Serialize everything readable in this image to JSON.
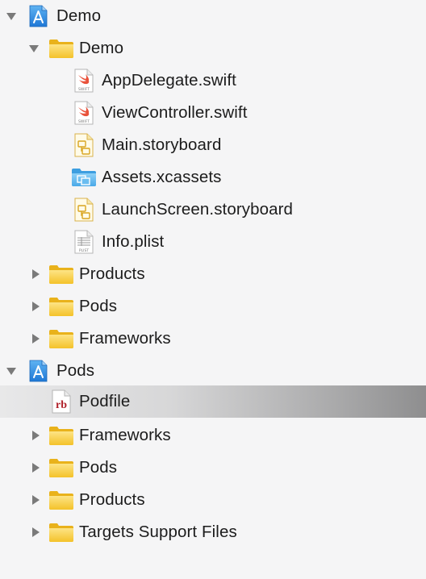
{
  "navigator": {
    "items": [
      {
        "label": "Demo",
        "icon": "xcode-project-icon",
        "state": "expanded"
      },
      {
        "label": "Demo",
        "icon": "folder-icon",
        "state": "expanded"
      },
      {
        "label": "AppDelegate.swift",
        "icon": "swift-file-icon",
        "badge": "SWIFT"
      },
      {
        "label": "ViewController.swift",
        "icon": "swift-file-icon",
        "badge": "SWIFT"
      },
      {
        "label": "Main.storyboard",
        "icon": "storyboard-file-icon"
      },
      {
        "label": "Assets.xcassets",
        "icon": "asset-catalog-icon"
      },
      {
        "label": "LaunchScreen.storyboard",
        "icon": "storyboard-file-icon"
      },
      {
        "label": "Info.plist",
        "icon": "plist-file-icon",
        "badge": "PLIST"
      },
      {
        "label": "Products",
        "icon": "folder-icon",
        "state": "collapsed"
      },
      {
        "label": "Pods",
        "icon": "folder-icon",
        "state": "collapsed"
      },
      {
        "label": "Frameworks",
        "icon": "folder-icon",
        "state": "collapsed"
      },
      {
        "label": "Pods",
        "icon": "xcode-project-icon",
        "state": "expanded"
      },
      {
        "label": "Podfile",
        "icon": "ruby-file-icon",
        "badge": "rb",
        "selected": true
      },
      {
        "label": "Frameworks",
        "icon": "folder-icon",
        "state": "collapsed"
      },
      {
        "label": "Pods",
        "icon": "folder-icon",
        "state": "collapsed"
      },
      {
        "label": "Products",
        "icon": "folder-icon",
        "state": "collapsed"
      },
      {
        "label": "Targets Support Files",
        "icon": "folder-icon",
        "state": "collapsed"
      }
    ]
  },
  "colors": {
    "background": "#f5f5f6",
    "folder": "#f6c92d",
    "project": "#2a8be0",
    "assets": "#5fb8ef",
    "swift": "#e9523b",
    "ruby": "#b0202a"
  }
}
